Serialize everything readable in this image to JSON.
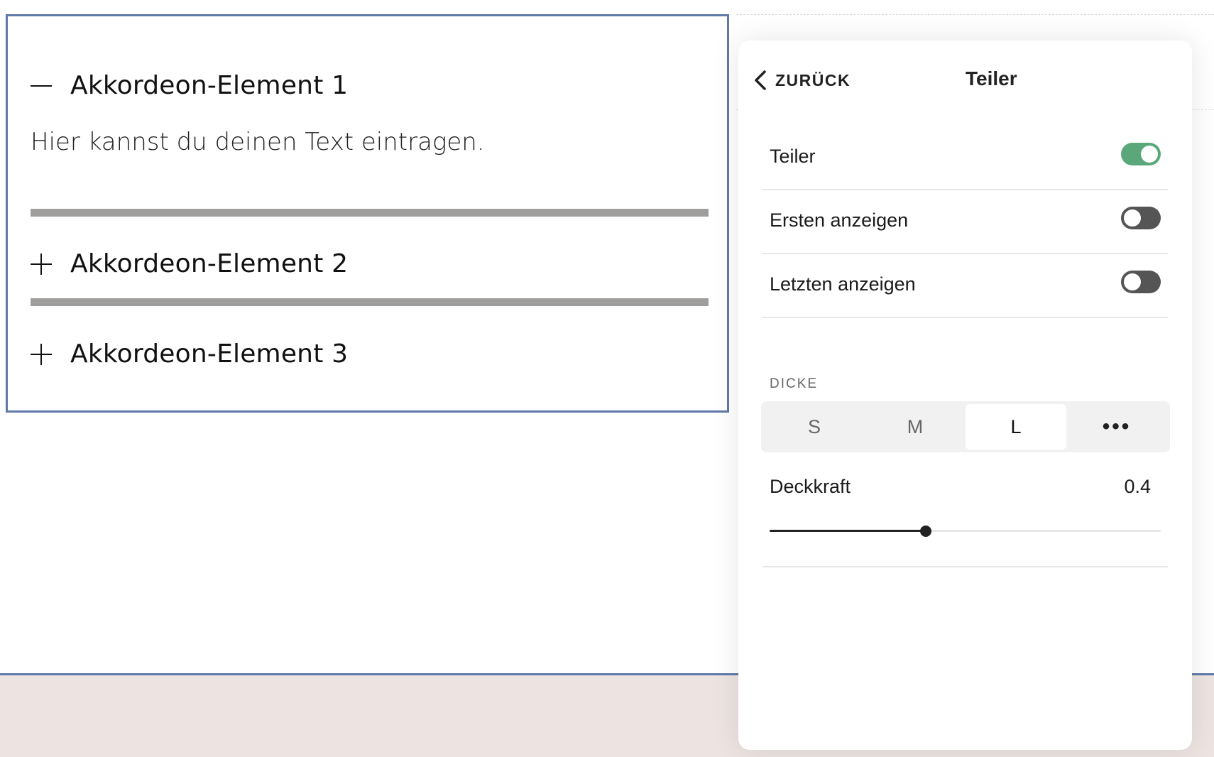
{
  "editor": {
    "items": [
      {
        "title": "Akkordeon-Element 1",
        "expanded": true,
        "icon": "minus-icon",
        "body": "Hier kannst du deinen Text eintragen."
      },
      {
        "title": "Akkordeon-Element 2",
        "expanded": false,
        "icon": "plus-icon"
      },
      {
        "title": "Akkordeon-Element 3",
        "expanded": false,
        "icon": "plus-icon"
      }
    ],
    "divider_color": "#a09d9d",
    "selection_color": "#5f79a8"
  },
  "panel": {
    "back_label": "ZURÜCK",
    "back_icon": "chevron-left-icon",
    "title": "Teiler",
    "toggles": [
      {
        "label": "Teiler",
        "on": true
      },
      {
        "label": "Ersten anzeigen",
        "on": false
      },
      {
        "label": "Letzten anzeigen",
        "on": false
      }
    ],
    "toggle_on_color": "#5aa87a",
    "thickness": {
      "label": "DICKE",
      "options": [
        "S",
        "M",
        "L",
        "•••"
      ],
      "selected": "L"
    },
    "opacity": {
      "label": "Deckkraft",
      "value": "0.4",
      "fraction": 0.4
    }
  },
  "footer_color": "#ede4e2"
}
